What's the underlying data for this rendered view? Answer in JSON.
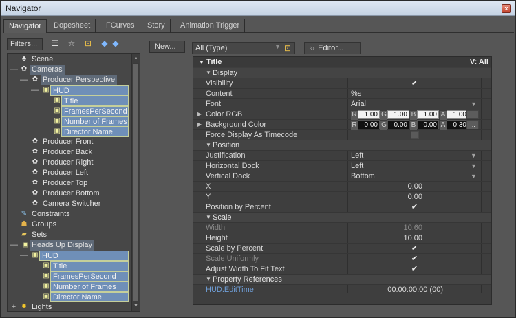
{
  "window": {
    "title": "Navigator",
    "close_glyph": "x"
  },
  "tabs": [
    "Navigator",
    "Dopesheet",
    "FCurves",
    "Story",
    "Animation Trigger"
  ],
  "toolbar": {
    "filters_label": "Filters..."
  },
  "tree": [
    {
      "label": "Scene"
    },
    {
      "label": "Cameras",
      "expander": "—"
    },
    {
      "label": "Producer Perspective",
      "expander": "—"
    },
    {
      "label": "HUD",
      "expander": "—"
    },
    {
      "label": "Title"
    },
    {
      "label": "FramesPerSecond"
    },
    {
      "label": "Number of Frames"
    },
    {
      "label": "Director Name"
    },
    {
      "label": "Producer Front"
    },
    {
      "label": "Producer Back"
    },
    {
      "label": "Producer Right"
    },
    {
      "label": "Producer Left"
    },
    {
      "label": "Producer Top"
    },
    {
      "label": "Producer Bottom"
    },
    {
      "label": "Camera Switcher"
    },
    {
      "label": "Constraints"
    },
    {
      "label": "Groups"
    },
    {
      "label": "Sets"
    },
    {
      "label": "Heads Up Display",
      "expander": "—"
    },
    {
      "label": "HUD",
      "expander": "—"
    },
    {
      "label": "Title"
    },
    {
      "label": "FramesPerSecond"
    },
    {
      "label": "Number of Frames"
    },
    {
      "label": "Director Name"
    },
    {
      "label": "Lights",
      "expander": "+"
    }
  ],
  "right": {
    "new_label": "New...",
    "type_filter": "All (Type)",
    "editor_label": "Editor..."
  },
  "properties": {
    "title": "Title",
    "visibility_col": "V: All",
    "rows": [
      {
        "name": "Display"
      },
      {
        "name": "Visibility"
      },
      {
        "name": "Content",
        "value": "%s"
      },
      {
        "name": "Font",
        "value": "Arial"
      },
      {
        "name": "Color RGB",
        "r": "1.00",
        "g": "1.00",
        "b": "1.00",
        "a": "1.00"
      },
      {
        "name": "Background Color",
        "r": "0.00",
        "g": "0.00",
        "b": "0.00",
        "a": "0.30"
      },
      {
        "name": "Force Display As Timecode"
      },
      {
        "name": "Position"
      },
      {
        "name": "Justification",
        "value": "Left"
      },
      {
        "name": "Horizontal Dock",
        "value": "Left"
      },
      {
        "name": "Vertical Dock",
        "value": "Bottom"
      },
      {
        "name": "X",
        "value": "0.00"
      },
      {
        "name": "Y",
        "value": "0.00"
      },
      {
        "name": "Position by Percent"
      },
      {
        "name": "Scale"
      },
      {
        "name": "Width",
        "value": "10.60"
      },
      {
        "name": "Height",
        "value": "10.00"
      },
      {
        "name": "Scale by Percent"
      },
      {
        "name": "Scale Uniformly"
      },
      {
        "name": "Adjust Width To Fit Text"
      },
      {
        "name": "Property References"
      },
      {
        "name": "HUD.EditTime",
        "value": "00:00:00:00 (00)"
      }
    ],
    "component_keys": {
      "r": "R",
      "g": "G",
      "b": "B",
      "a": "A"
    },
    "ellipsis": "..."
  }
}
